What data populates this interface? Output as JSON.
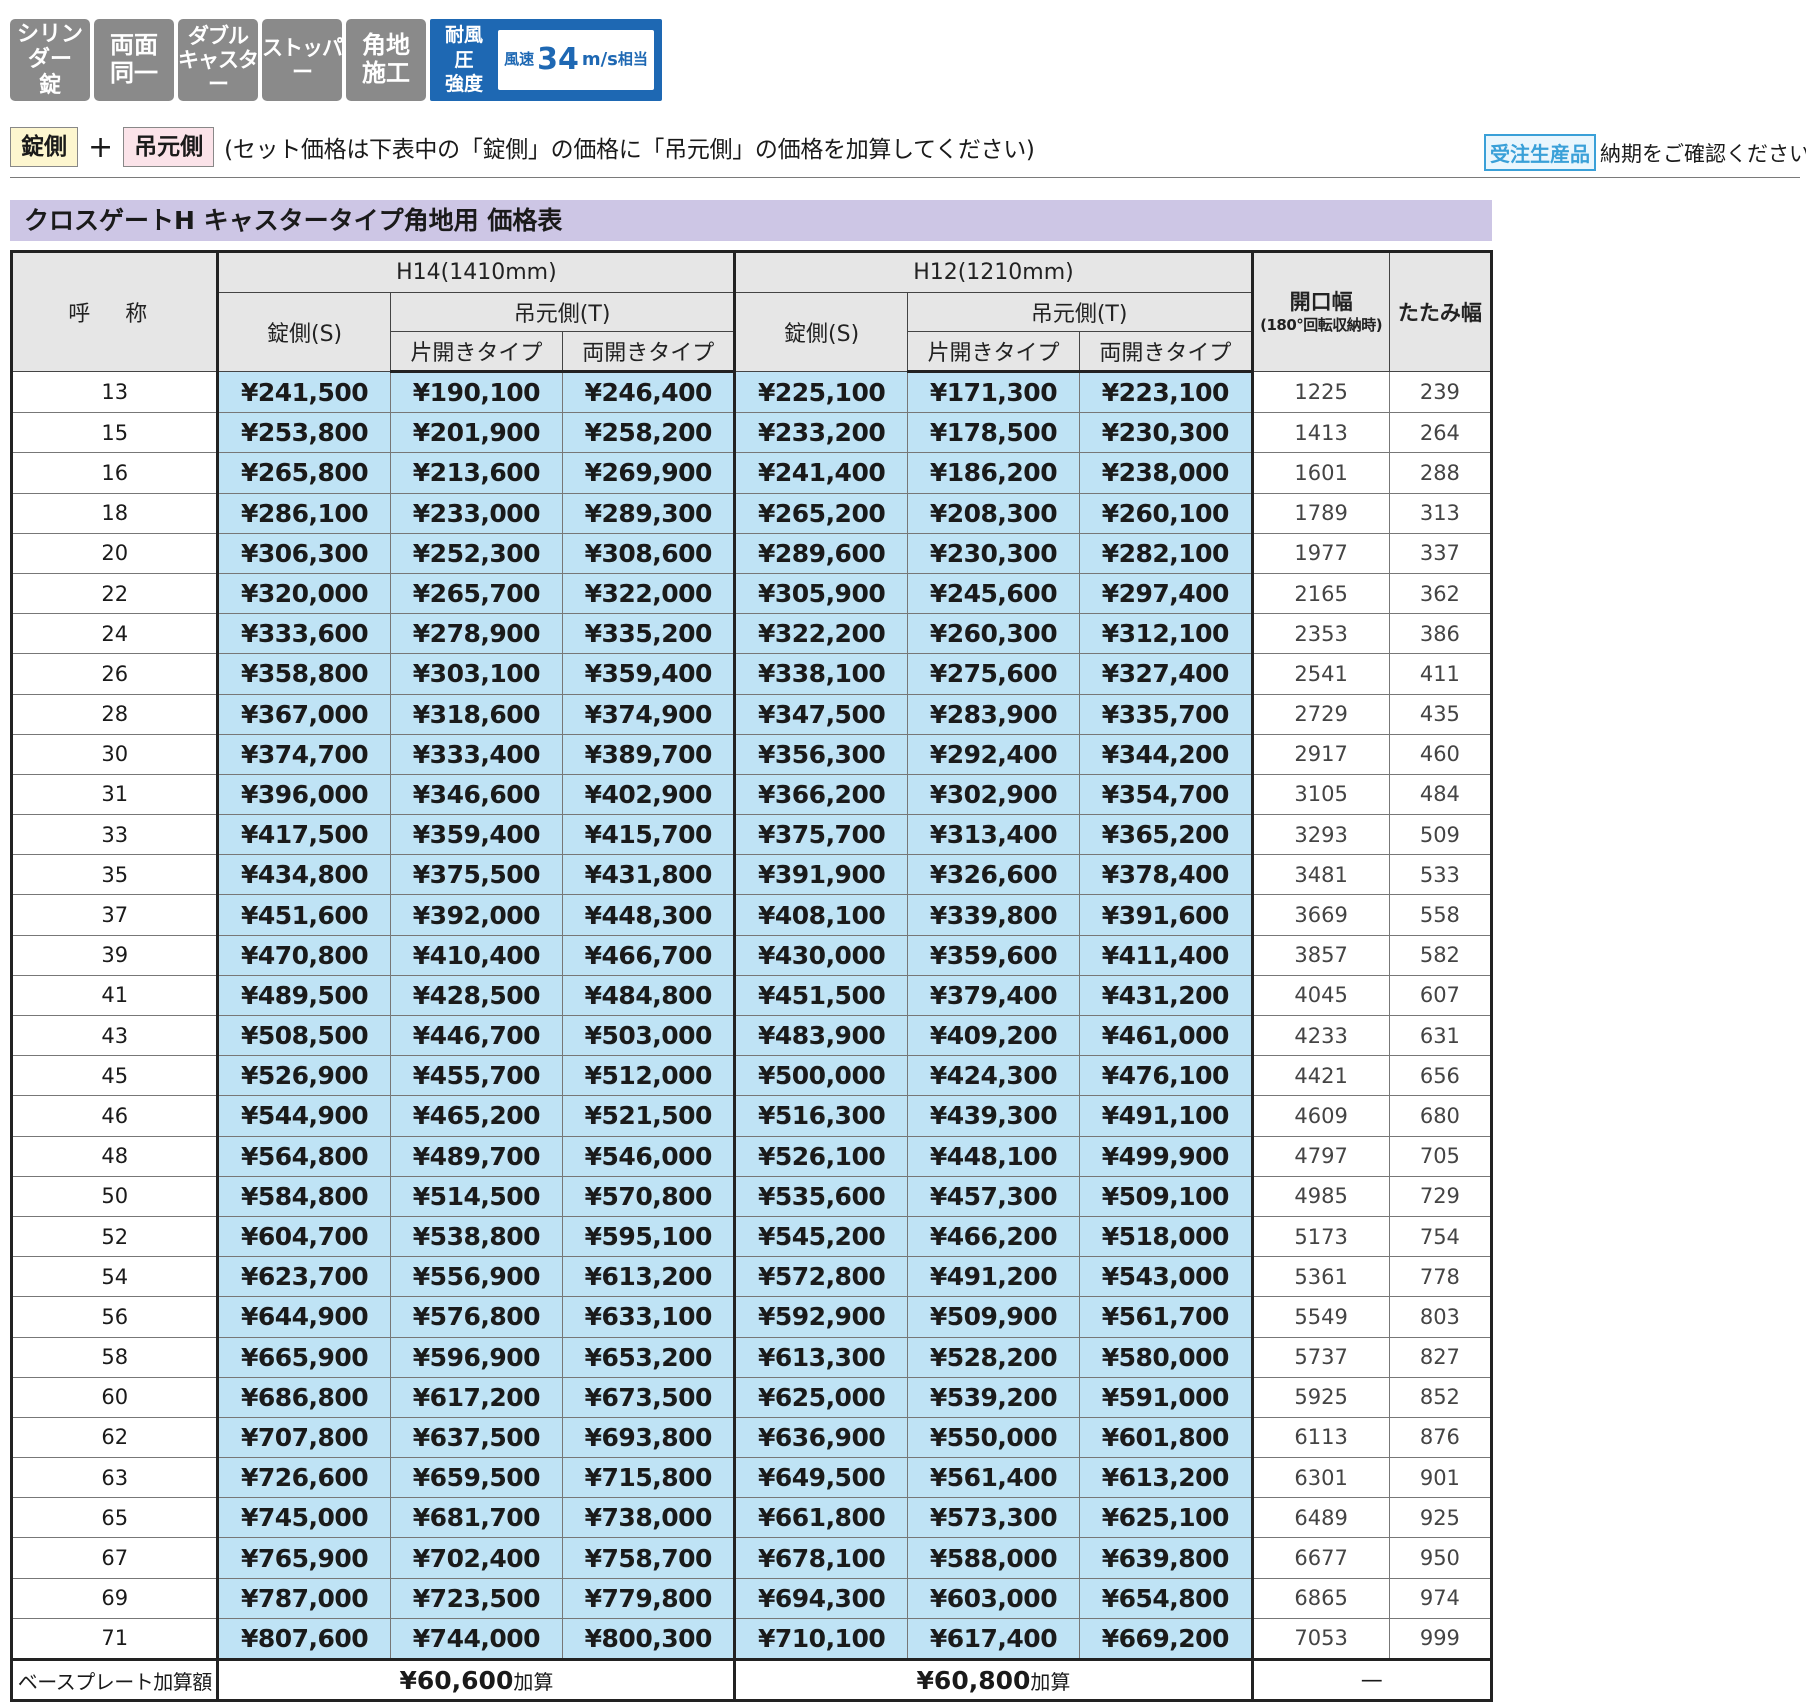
{
  "badges": [
    {
      "line1": "シリンダー",
      "line2": "錠"
    },
    {
      "line1": "両面",
      "line2": "同一"
    },
    {
      "line1": "ダブル",
      "line2": "キャスター"
    },
    {
      "line1": "ストッパー",
      "line2": ""
    },
    {
      "line1": "角地",
      "line2": "施工"
    }
  ],
  "wind": {
    "label1": "耐風圧",
    "label2": "強度",
    "prefix": "風速",
    "value": "34",
    "unit": "m/s",
    "suffix": "相当"
  },
  "legend": {
    "lock_tag": "錠側",
    "plus": "+",
    "hinge_tag": "吊元側",
    "note": "(セット価格は下表中の「錠側」の価格に「吊元側」の価格を加算してください)"
  },
  "order": {
    "tag": "受注生産品",
    "text": "納期をご確認ください。"
  },
  "title": "クロスゲートH キャスタータイプ角地用 価格表",
  "headers": {
    "name": "呼 称",
    "h14": "H14(1410mm)",
    "h12": "H12(1210mm)",
    "lock_side": "錠側(S)",
    "hinge_side": "吊元側(T)",
    "single": "片開きタイプ",
    "double": "両開きタイプ",
    "opening": "開口幅",
    "opening_note": "(180°回転収納時)",
    "fold": "たたみ幅"
  },
  "rows": [
    {
      "name": "13",
      "h14_s": "¥241,500",
      "h14_t1": "¥190,100",
      "h14_t2": "¥246,400",
      "h12_s": "¥225,100",
      "h12_t1": "¥171,300",
      "h12_t2": "¥223,100",
      "open": "1225",
      "fold": "239"
    },
    {
      "name": "15",
      "h14_s": "¥253,800",
      "h14_t1": "¥201,900",
      "h14_t2": "¥258,200",
      "h12_s": "¥233,200",
      "h12_t1": "¥178,500",
      "h12_t2": "¥230,300",
      "open": "1413",
      "fold": "264"
    },
    {
      "name": "16",
      "h14_s": "¥265,800",
      "h14_t1": "¥213,600",
      "h14_t2": "¥269,900",
      "h12_s": "¥241,400",
      "h12_t1": "¥186,200",
      "h12_t2": "¥238,000",
      "open": "1601",
      "fold": "288"
    },
    {
      "name": "18",
      "h14_s": "¥286,100",
      "h14_t1": "¥233,000",
      "h14_t2": "¥289,300",
      "h12_s": "¥265,200",
      "h12_t1": "¥208,300",
      "h12_t2": "¥260,100",
      "open": "1789",
      "fold": "313"
    },
    {
      "name": "20",
      "h14_s": "¥306,300",
      "h14_t1": "¥252,300",
      "h14_t2": "¥308,600",
      "h12_s": "¥289,600",
      "h12_t1": "¥230,300",
      "h12_t2": "¥282,100",
      "open": "1977",
      "fold": "337"
    },
    {
      "name": "22",
      "h14_s": "¥320,000",
      "h14_t1": "¥265,700",
      "h14_t2": "¥322,000",
      "h12_s": "¥305,900",
      "h12_t1": "¥245,600",
      "h12_t2": "¥297,400",
      "open": "2165",
      "fold": "362"
    },
    {
      "name": "24",
      "h14_s": "¥333,600",
      "h14_t1": "¥278,900",
      "h14_t2": "¥335,200",
      "h12_s": "¥322,200",
      "h12_t1": "¥260,300",
      "h12_t2": "¥312,100",
      "open": "2353",
      "fold": "386"
    },
    {
      "name": "26",
      "h14_s": "¥358,800",
      "h14_t1": "¥303,100",
      "h14_t2": "¥359,400",
      "h12_s": "¥338,100",
      "h12_t1": "¥275,600",
      "h12_t2": "¥327,400",
      "open": "2541",
      "fold": "411"
    },
    {
      "name": "28",
      "h14_s": "¥367,000",
      "h14_t1": "¥318,600",
      "h14_t2": "¥374,900",
      "h12_s": "¥347,500",
      "h12_t1": "¥283,900",
      "h12_t2": "¥335,700",
      "open": "2729",
      "fold": "435"
    },
    {
      "name": "30",
      "h14_s": "¥374,700",
      "h14_t1": "¥333,400",
      "h14_t2": "¥389,700",
      "h12_s": "¥356,300",
      "h12_t1": "¥292,400",
      "h12_t2": "¥344,200",
      "open": "2917",
      "fold": "460"
    },
    {
      "name": "31",
      "h14_s": "¥396,000",
      "h14_t1": "¥346,600",
      "h14_t2": "¥402,900",
      "h12_s": "¥366,200",
      "h12_t1": "¥302,900",
      "h12_t2": "¥354,700",
      "open": "3105",
      "fold": "484"
    },
    {
      "name": "33",
      "h14_s": "¥417,500",
      "h14_t1": "¥359,400",
      "h14_t2": "¥415,700",
      "h12_s": "¥375,700",
      "h12_t1": "¥313,400",
      "h12_t2": "¥365,200",
      "open": "3293",
      "fold": "509"
    },
    {
      "name": "35",
      "h14_s": "¥434,800",
      "h14_t1": "¥375,500",
      "h14_t2": "¥431,800",
      "h12_s": "¥391,900",
      "h12_t1": "¥326,600",
      "h12_t2": "¥378,400",
      "open": "3481",
      "fold": "533"
    },
    {
      "name": "37",
      "h14_s": "¥451,600",
      "h14_t1": "¥392,000",
      "h14_t2": "¥448,300",
      "h12_s": "¥408,100",
      "h12_t1": "¥339,800",
      "h12_t2": "¥391,600",
      "open": "3669",
      "fold": "558"
    },
    {
      "name": "39",
      "h14_s": "¥470,800",
      "h14_t1": "¥410,400",
      "h14_t2": "¥466,700",
      "h12_s": "¥430,000",
      "h12_t1": "¥359,600",
      "h12_t2": "¥411,400",
      "open": "3857",
      "fold": "582"
    },
    {
      "name": "41",
      "h14_s": "¥489,500",
      "h14_t1": "¥428,500",
      "h14_t2": "¥484,800",
      "h12_s": "¥451,500",
      "h12_t1": "¥379,400",
      "h12_t2": "¥431,200",
      "open": "4045",
      "fold": "607"
    },
    {
      "name": "43",
      "h14_s": "¥508,500",
      "h14_t1": "¥446,700",
      "h14_t2": "¥503,000",
      "h12_s": "¥483,900",
      "h12_t1": "¥409,200",
      "h12_t2": "¥461,000",
      "open": "4233",
      "fold": "631"
    },
    {
      "name": "45",
      "h14_s": "¥526,900",
      "h14_t1": "¥455,700",
      "h14_t2": "¥512,000",
      "h12_s": "¥500,000",
      "h12_t1": "¥424,300",
      "h12_t2": "¥476,100",
      "open": "4421",
      "fold": "656"
    },
    {
      "name": "46",
      "h14_s": "¥544,900",
      "h14_t1": "¥465,200",
      "h14_t2": "¥521,500",
      "h12_s": "¥516,300",
      "h12_t1": "¥439,300",
      "h12_t2": "¥491,100",
      "open": "4609",
      "fold": "680"
    },
    {
      "name": "48",
      "h14_s": "¥564,800",
      "h14_t1": "¥489,700",
      "h14_t2": "¥546,000",
      "h12_s": "¥526,100",
      "h12_t1": "¥448,100",
      "h12_t2": "¥499,900",
      "open": "4797",
      "fold": "705"
    },
    {
      "name": "50",
      "h14_s": "¥584,800",
      "h14_t1": "¥514,500",
      "h14_t2": "¥570,800",
      "h12_s": "¥535,600",
      "h12_t1": "¥457,300",
      "h12_t2": "¥509,100",
      "open": "4985",
      "fold": "729"
    },
    {
      "name": "52",
      "h14_s": "¥604,700",
      "h14_t1": "¥538,800",
      "h14_t2": "¥595,100",
      "h12_s": "¥545,200",
      "h12_t1": "¥466,200",
      "h12_t2": "¥518,000",
      "open": "5173",
      "fold": "754"
    },
    {
      "name": "54",
      "h14_s": "¥623,700",
      "h14_t1": "¥556,900",
      "h14_t2": "¥613,200",
      "h12_s": "¥572,800",
      "h12_t1": "¥491,200",
      "h12_t2": "¥543,000",
      "open": "5361",
      "fold": "778"
    },
    {
      "name": "56",
      "h14_s": "¥644,900",
      "h14_t1": "¥576,800",
      "h14_t2": "¥633,100",
      "h12_s": "¥592,900",
      "h12_t1": "¥509,900",
      "h12_t2": "¥561,700",
      "open": "5549",
      "fold": "803"
    },
    {
      "name": "58",
      "h14_s": "¥665,900",
      "h14_t1": "¥596,900",
      "h14_t2": "¥653,200",
      "h12_s": "¥613,300",
      "h12_t1": "¥528,200",
      "h12_t2": "¥580,000",
      "open": "5737",
      "fold": "827"
    },
    {
      "name": "60",
      "h14_s": "¥686,800",
      "h14_t1": "¥617,200",
      "h14_t2": "¥673,500",
      "h12_s": "¥625,000",
      "h12_t1": "¥539,200",
      "h12_t2": "¥591,000",
      "open": "5925",
      "fold": "852"
    },
    {
      "name": "62",
      "h14_s": "¥707,800",
      "h14_t1": "¥637,500",
      "h14_t2": "¥693,800",
      "h12_s": "¥636,900",
      "h12_t1": "¥550,000",
      "h12_t2": "¥601,800",
      "open": "6113",
      "fold": "876"
    },
    {
      "name": "63",
      "h14_s": "¥726,600",
      "h14_t1": "¥659,500",
      "h14_t2": "¥715,800",
      "h12_s": "¥649,500",
      "h12_t1": "¥561,400",
      "h12_t2": "¥613,200",
      "open": "6301",
      "fold": "901"
    },
    {
      "name": "65",
      "h14_s": "¥745,000",
      "h14_t1": "¥681,700",
      "h14_t2": "¥738,000",
      "h12_s": "¥661,800",
      "h12_t1": "¥573,300",
      "h12_t2": "¥625,100",
      "open": "6489",
      "fold": "925"
    },
    {
      "name": "67",
      "h14_s": "¥765,900",
      "h14_t1": "¥702,400",
      "h14_t2": "¥758,700",
      "h12_s": "¥678,100",
      "h12_t1": "¥588,000",
      "h12_t2": "¥639,800",
      "open": "6677",
      "fold": "950"
    },
    {
      "name": "69",
      "h14_s": "¥787,000",
      "h14_t1": "¥723,500",
      "h14_t2": "¥779,800",
      "h12_s": "¥694,300",
      "h12_t1": "¥603,000",
      "h12_t2": "¥654,800",
      "open": "6865",
      "fold": "974"
    },
    {
      "name": "71",
      "h14_s": "¥807,600",
      "h14_t1": "¥744,000",
      "h14_t2": "¥800,300",
      "h12_s": "¥710,100",
      "h12_t1": "¥617,400",
      "h12_t2": "¥669,200",
      "open": "7053",
      "fold": "999"
    }
  ],
  "footer": {
    "label": "ベースプレート加算額",
    "h14_value": "¥60,600",
    "h12_value": "¥60,800",
    "add": "加算",
    "dash": "—"
  }
}
